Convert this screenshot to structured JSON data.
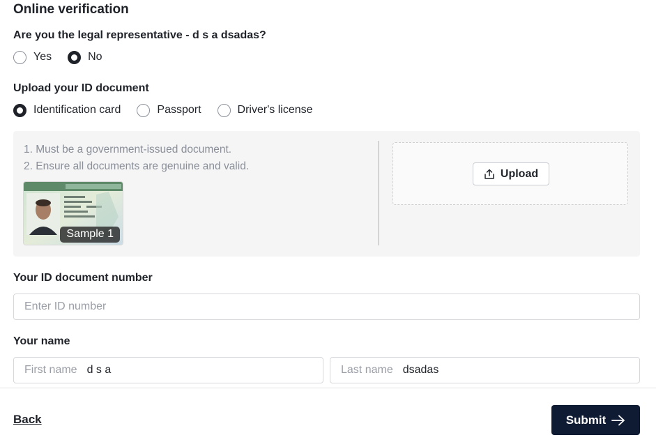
{
  "page": {
    "title": "Online verification"
  },
  "legal_rep": {
    "question": "Are you the legal representative - d s a dsadas?",
    "options": [
      {
        "label": "Yes",
        "checked": false
      },
      {
        "label": "No",
        "checked": true
      }
    ]
  },
  "id_doc": {
    "label": "Upload your ID document",
    "options": [
      {
        "label": "Identification card",
        "checked": true
      },
      {
        "label": "Passport",
        "checked": false
      },
      {
        "label": "Driver's license",
        "checked": false
      }
    ]
  },
  "upload_panel": {
    "instructions": [
      "1. Must be a government-issued document.",
      "2. Ensure all documents are genuine and valid."
    ],
    "sample_label": "Sample 1",
    "upload_label": "Upload"
  },
  "id_number": {
    "label": "Your ID document number",
    "placeholder": "Enter ID number",
    "value": ""
  },
  "name": {
    "label": "Your name",
    "first": {
      "placeholder": "First name",
      "value": "d s a"
    },
    "last": {
      "placeholder": "Last name",
      "value": "dsadas"
    }
  },
  "footer": {
    "back_label": "Back",
    "submit_label": "Submit"
  },
  "colors": {
    "primary": "#0e1b33",
    "panel_bg": "#f5f5f5",
    "muted_text": "#8a8f99"
  },
  "icons": {
    "upload": "upload-icon",
    "submit": "arrow-right-icon"
  }
}
